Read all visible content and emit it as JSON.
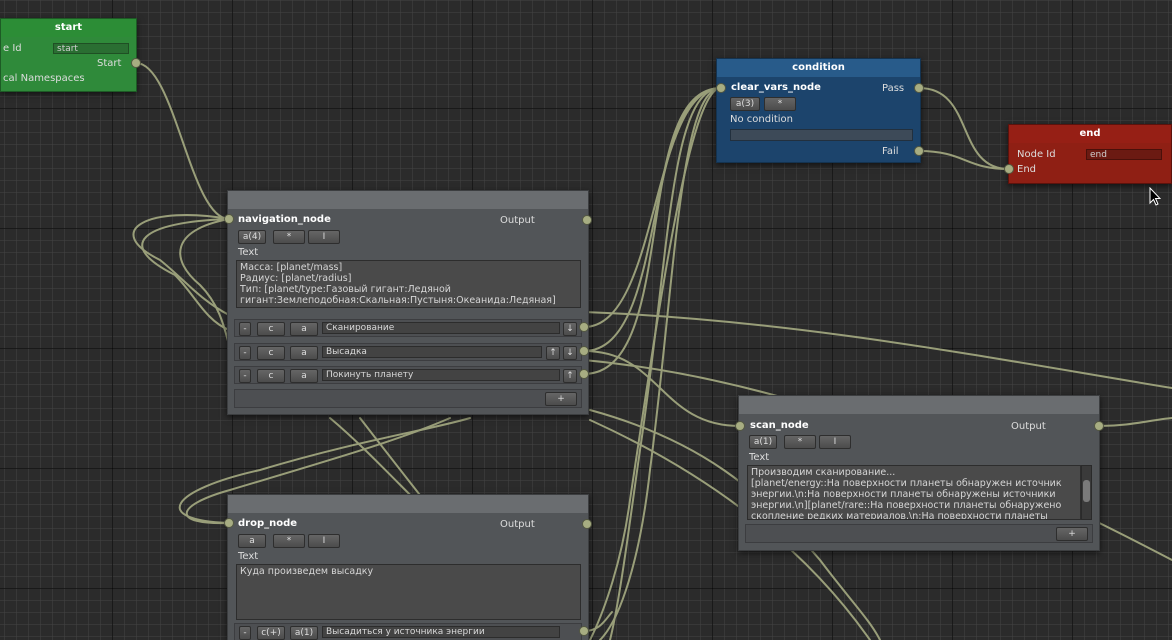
{
  "start": {
    "title": "start",
    "node_id_label": "e Id",
    "node_id_value": "start",
    "start_label": "Start",
    "namespaces_label": "cal Namespaces"
  },
  "condition": {
    "title": "condition",
    "node_name": "clear_vars_node",
    "pass_label": "Pass",
    "fail_label": "Fail",
    "btn_a": "a(3)",
    "btn_star": "*",
    "no_condition": "No condition",
    "condition_value": ""
  },
  "end": {
    "title": "end",
    "node_id_label": "Node Id",
    "node_id_value": "end",
    "end_label": "End"
  },
  "navigation": {
    "node_name": "navigation_node",
    "output_label": "Output",
    "btn_a": "a(4)",
    "btn_star": "*",
    "btn_i": "I",
    "text_label": "Text",
    "text_lines": [
      "Масса: [planet/mass]",
      "Радиус: [planet/radius]",
      "Тип: [planet/type:Газовый гигант:Ледяной",
      "гигант:Землеподобная:Скальная:Пустыня:Океанида:Ледяная]"
    ],
    "options": [
      {
        "minus": "-",
        "c": "c",
        "a": "a",
        "text": "Сканирование",
        "arrows": [
          "↓"
        ]
      },
      {
        "minus": "-",
        "c": "c",
        "a": "a",
        "text": "Высадка",
        "arrows": [
          "↑",
          "↓"
        ]
      },
      {
        "minus": "-",
        "c": "c",
        "a": "a",
        "text": "Покинуть планету",
        "arrows": [
          "↑"
        ]
      }
    ],
    "add_btn": "+"
  },
  "scan": {
    "node_name": "scan_node",
    "output_label": "Output",
    "btn_a": "a(1)",
    "btn_star": "*",
    "btn_i": "I",
    "text_label": "Text",
    "text_lines": [
      "Производим сканирование...",
      "[planet/energy::На поверхности планеты обнаружен источник",
      "энергии.\\n:На поверхности планеты обнаружены источники",
      "энергии.\\n][planet/rare::На поверхности планеты обнаружено",
      "скопление редких материалов.\\n:На поверхности планеты"
    ],
    "add_btn": "+"
  },
  "drop": {
    "node_name": "drop_node",
    "output_label": "Output",
    "btn_a": "a",
    "btn_star": "*",
    "btn_i": "I",
    "text_label": "Text",
    "text_value": "Куда произведем высадку",
    "option": {
      "minus": "-",
      "c": "c(+)",
      "a": "a(1)",
      "text": "Высадиться у источника энергии"
    }
  },
  "colors": {
    "wire": "#a5ab82",
    "start_header": "#2f8a3a",
    "condition_header": "#24527e",
    "end_header": "#8f1f14",
    "node_body": "#525558"
  }
}
